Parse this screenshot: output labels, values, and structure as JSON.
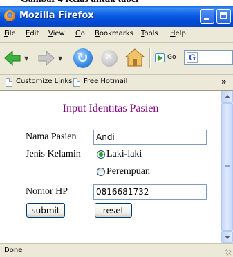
{
  "caption": "Gambar 4 Kelas untuk tabel",
  "window": {
    "title": "Mozilla Firefox"
  },
  "menu": [
    "File",
    "Edit",
    "View",
    "Go",
    "Bookmarks",
    "Tools",
    "Help"
  ],
  "toolbar": {
    "go_label": "Go",
    "search_engine": "G"
  },
  "bookmarks": [
    {
      "label": "Customize Links"
    },
    {
      "label": "Free Hotmail"
    }
  ],
  "form": {
    "title": "Input Identitas Pasien",
    "nama_label": "Nama Pasien",
    "nama_value": "Andi",
    "gender_label": "Jenis Kelamin",
    "gender_options": [
      "Laki-laki",
      "Perempuan"
    ],
    "gender_selected": "Laki-laki",
    "hp_label": "Nomor HP",
    "hp_value": "0816681732",
    "submit_label": "submit",
    "reset_label": "reset"
  },
  "status": "Done",
  "colors": {
    "title_color": "#800080",
    "titlebar": "#0a5fd8"
  }
}
